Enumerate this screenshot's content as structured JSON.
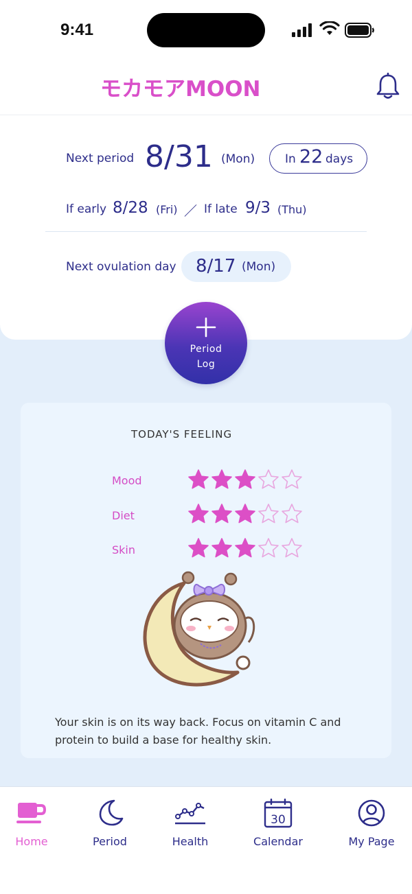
{
  "status_bar": {
    "time": "9:41"
  },
  "header": {
    "logo_text": "モカモアMOON"
  },
  "period": {
    "next_label": "Next period",
    "next_date": "8/31",
    "next_day": "(Mon)",
    "countdown_prefix": "In",
    "countdown_number": "22",
    "countdown_suffix": "days",
    "early_label": "If early",
    "early_date": "8/28",
    "early_day": "(Fri)",
    "separator": "／",
    "late_label": "If late",
    "late_date": "9/3",
    "late_day": "(Thu)",
    "ovulation_label": "Next ovulation day",
    "ovulation_date": "8/17",
    "ovulation_day": "(Mon)"
  },
  "fab": {
    "line1": "Period",
    "line2": "Log"
  },
  "feeling": {
    "title": "TODAY'S FEELING",
    "ratings": [
      {
        "label": "Mood",
        "value": 3,
        "max": 5
      },
      {
        "label": "Diet",
        "value": 3,
        "max": 5
      },
      {
        "label": "Skin",
        "value": 3,
        "max": 5
      }
    ],
    "message": "Your skin is on its way back. Focus on vitamin C and protein to build a base for healthy skin."
  },
  "tabs": [
    {
      "label": "Home",
      "icon": "cup-icon",
      "active": true
    },
    {
      "label": "Period",
      "icon": "moon-icon",
      "active": false
    },
    {
      "label": "Health",
      "icon": "chart-icon",
      "active": false
    },
    {
      "label": "Calendar",
      "icon": "calendar-icon",
      "active": false,
      "badge": "30"
    },
    {
      "label": "My Page",
      "icon": "user-icon",
      "active": false
    }
  ],
  "colors": {
    "accent": "#d94fc9",
    "navy": "#2d2d8a",
    "background": "#e3eefa",
    "star_fill": "#dc4fc6"
  }
}
